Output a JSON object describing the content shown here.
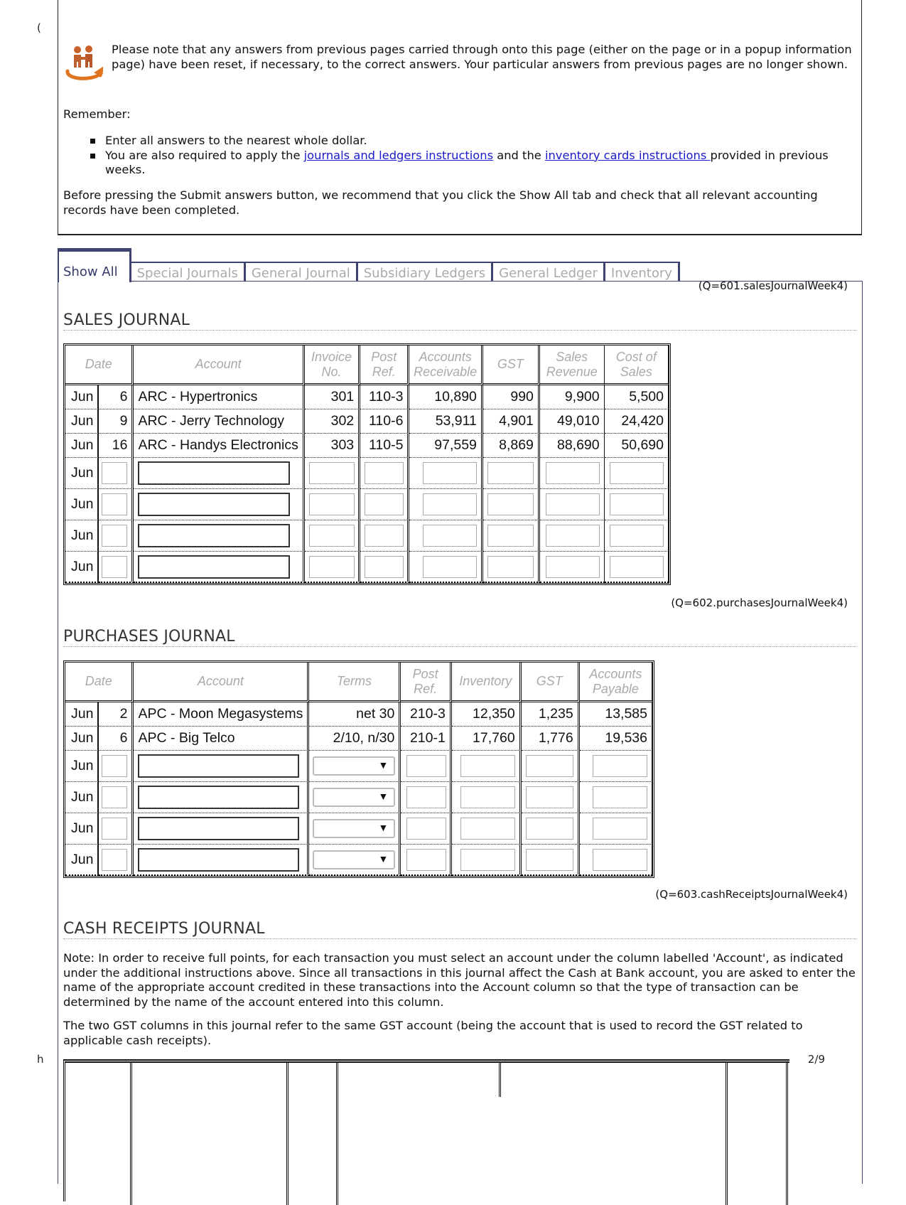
{
  "page": {
    "left_margin_top": "(",
    "left_margin_bottom": "h",
    "page_number": "2/9"
  },
  "notice": {
    "icon": "handshake-people-icon",
    "text": "Please note that any answers from previous pages carried through onto this page (either on the page or in a popup information page) have been reset, if necessary, to the correct answers. Your particular answers from previous pages are no longer shown.",
    "remember_label": "Remember:",
    "bullet1": "Enter all answers to the nearest whole dollar.",
    "bullet2_pre": "You are also required to apply the ",
    "bullet2_link1": "journals and ledgers instructions",
    "bullet2_mid": " and the ",
    "bullet2_link2": "inventory cards instructions ",
    "bullet2_post": "provided in previous weeks.",
    "before_text": "Before pressing the Submit answers button, we recommend that you click the Show All tab and check that all relevant accounting records have been completed."
  },
  "tabs": [
    {
      "label": "Show All",
      "active": true
    },
    {
      "label": "Special Journals",
      "active": false
    },
    {
      "label": "General Journal",
      "active": false
    },
    {
      "label": "Subsidiary Ledgers",
      "active": false
    },
    {
      "label": "General Ledger",
      "active": false
    },
    {
      "label": "Inventory",
      "active": false
    }
  ],
  "colors": {
    "tab_border": "#3d4270",
    "active_tab_text": "#353a6a",
    "inactive_tab_text": "#aaaaaa",
    "link": "#1a1ac8",
    "header_text": "#aaaaaa"
  },
  "sales_journal": {
    "qref": "(Q=601.salesJournalWeek4)",
    "title": "SALES JOURNAL",
    "headers": {
      "date": "Date",
      "account": "Account",
      "invoice_1": "Invoice",
      "invoice_2": "No.",
      "post_1": "Post",
      "post_2": "Ref.",
      "ar_1": "Accounts",
      "ar_2": "Receivable",
      "gst": "GST",
      "sales_1": "Sales",
      "sales_2": "Revenue",
      "cos_1": "Cost of",
      "cos_2": "Sales"
    },
    "rows": [
      {
        "month": "Jun",
        "day": "6",
        "account": "ARC - Hypertronics",
        "invoice": "301",
        "post_ref": "110-3",
        "ar": "10,890",
        "gst": "990",
        "sales": "9,900",
        "cos": "5,500"
      },
      {
        "month": "Jun",
        "day": "9",
        "account": "ARC - Jerry Technology",
        "invoice": "302",
        "post_ref": "110-6",
        "ar": "53,911",
        "gst": "4,901",
        "sales": "49,010",
        "cos": "24,420"
      },
      {
        "month": "Jun",
        "day": "16",
        "account": "ARC - Handys Electronics",
        "invoice": "303",
        "post_ref": "110-5",
        "ar": "97,559",
        "gst": "8,869",
        "sales": "88,690",
        "cos": "50,690"
      }
    ],
    "blank_rows": [
      {
        "month": "Jun",
        "day": "",
        "account": "",
        "invoice": "",
        "post_ref": "",
        "ar": "",
        "gst": "",
        "sales": "",
        "cos": ""
      },
      {
        "month": "Jun",
        "day": "",
        "account": "",
        "invoice": "",
        "post_ref": "",
        "ar": "",
        "gst": "",
        "sales": "",
        "cos": ""
      },
      {
        "month": "Jun",
        "day": "",
        "account": "",
        "invoice": "",
        "post_ref": "",
        "ar": "",
        "gst": "",
        "sales": "",
        "cos": ""
      },
      {
        "month": "Jun",
        "day": "",
        "account": "",
        "invoice": "",
        "post_ref": "",
        "ar": "",
        "gst": "",
        "sales": "",
        "cos": ""
      }
    ]
  },
  "purchases_journal": {
    "qref": "(Q=602.purchasesJournalWeek4)",
    "title": "PURCHASES JOURNAL",
    "headers": {
      "date": "Date",
      "account": "Account",
      "terms": "Terms",
      "post_1": "Post",
      "post_2": "Ref.",
      "inventory": "Inventory",
      "gst": "GST",
      "ap_1": "Accounts",
      "ap_2": "Payable"
    },
    "rows": [
      {
        "month": "Jun",
        "day": "2",
        "account": "APC - Moon Megasystems",
        "terms": "net 30",
        "post_ref": "210-3",
        "inventory": "12,350",
        "gst": "1,235",
        "ap": "13,585"
      },
      {
        "month": "Jun",
        "day": "6",
        "account": "APC - Big Telco",
        "terms": "2/10, n/30",
        "post_ref": "210-1",
        "inventory": "17,760",
        "gst": "1,776",
        "ap": "19,536"
      }
    ],
    "blank_rows": [
      {
        "month": "Jun",
        "day": "",
        "account": "",
        "terms": "",
        "post_ref": "",
        "inventory": "",
        "gst": "",
        "ap": ""
      },
      {
        "month": "Jun",
        "day": "",
        "account": "",
        "terms": "",
        "post_ref": "",
        "inventory": "",
        "gst": "",
        "ap": ""
      },
      {
        "month": "Jun",
        "day": "",
        "account": "",
        "terms": "",
        "post_ref": "",
        "inventory": "",
        "gst": "",
        "ap": ""
      },
      {
        "month": "Jun",
        "day": "",
        "account": "",
        "terms": "",
        "post_ref": "",
        "inventory": "",
        "gst": "",
        "ap": ""
      }
    ],
    "dropdown_arrow": "▼"
  },
  "cash_receipts_journal": {
    "qref": "(Q=603.cashReceiptsJournalWeek4)",
    "title": "CASH RECEIPTS JOURNAL",
    "note1": "Note: In order to receive full points, for each transaction you must select an account under the column labelled 'Account', as indicated under the additional instructions above. Since all transactions in this journal affect the Cash at Bank account, you are asked to enter the name of the appropriate account credited in these transactions into the Account column so that the type of transaction can be determined by the name of the account entered into this column.",
    "note2": "The two GST columns in this journal refer to the same GST account (being the account that is used to record the GST related to applicable cash receipts)."
  }
}
